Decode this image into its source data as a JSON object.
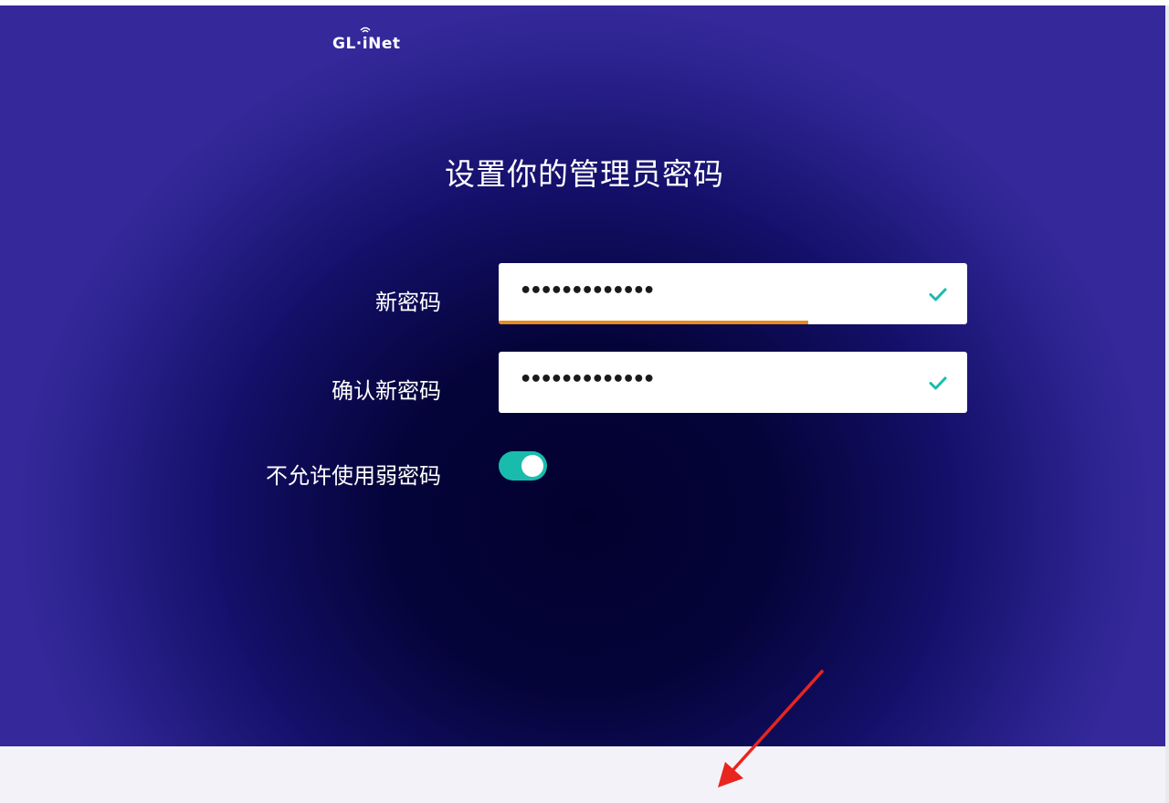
{
  "logo": {
    "left": "GL",
    "dot": "·",
    "right": "iNet",
    "icon": "wifi-icon"
  },
  "title": "设置你的管理员密码",
  "form": {
    "new_password": {
      "label": "新密码",
      "value": "•••••••••••••",
      "status_icon": "check-icon",
      "strength_fraction": 0.66
    },
    "confirm_password": {
      "label": "确认新密码",
      "value": "•••••••••••••",
      "status_icon": "check-icon"
    },
    "disallow_weak": {
      "label": "不允许使用弱密码",
      "on": true
    }
  },
  "annotation": {
    "icon": "red-arrow-icon"
  },
  "colors": {
    "accent": "#19bcac",
    "strength": "#e88a1c",
    "background_edge": "#34289a",
    "background_center": "#02012e",
    "footer": "#f3f2f8",
    "arrow": "#e8251f"
  }
}
